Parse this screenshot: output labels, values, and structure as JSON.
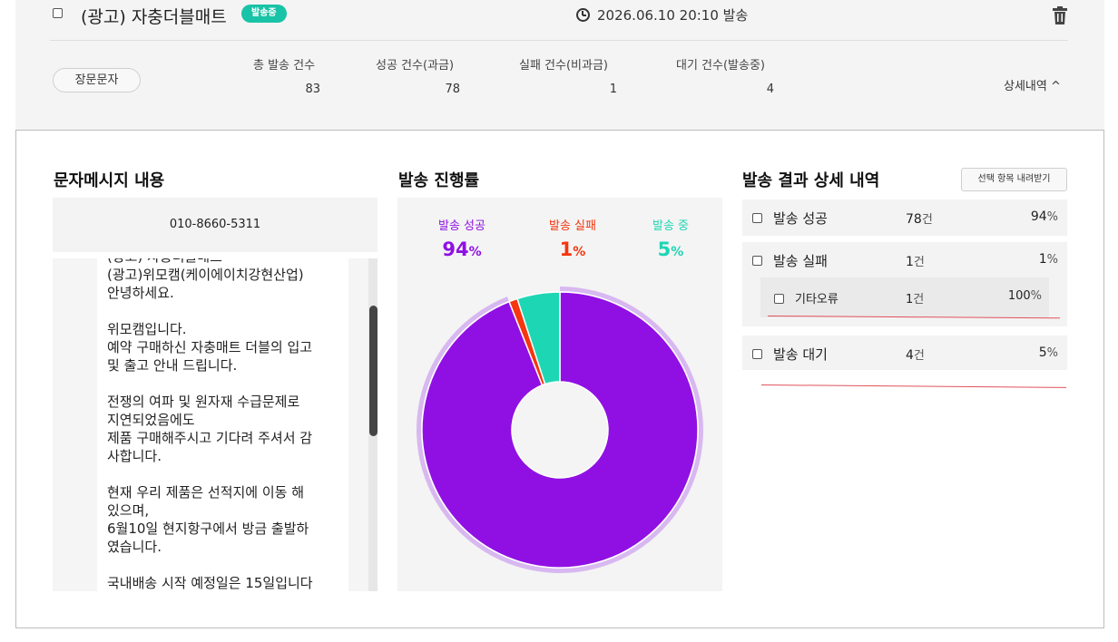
{
  "header": {
    "title": "(광고) 자충더블매트",
    "status_badge": "발송중",
    "scheduled": "2026.06.10 20:10 발송",
    "message_type": "장문문자",
    "detail_toggle": "상세내역 ^"
  },
  "stats": {
    "headers": [
      "총 발송 건수",
      "성공 건수(과금)",
      "실패 건수(비과금)",
      "대기 건수(발송중)"
    ],
    "values": [
      "83",
      "78",
      "1",
      "4"
    ]
  },
  "message": {
    "section_title": "문자메시지 내용",
    "phone": "010-8660-5311",
    "body": "(광고) 자충더블매트\n(광고)위모캠(케이에이치강현산업)\n안녕하세요.\n\n위모캠입니다.\n예약 구매하신 자충매트 더블의 입고\n및 출고 안내 드립니다.\n\n전쟁의 여파 및 원자재 수급문제로\n지연되었음에도\n제품 구매해주시고 기다려 주셔서 감\n사합니다.\n\n현재 우리 제품은 선적지에 이동 해\n있으며,\n6월10일 현지항구에서 방금 출발하\n였습니다.\n\n국내배송 시작 예정일은 15일입니다"
  },
  "progress": {
    "section_title": "발송 진행률",
    "legend": [
      {
        "label": "발송 성공",
        "value": "94",
        "unit": "%",
        "color": "#9010e3"
      },
      {
        "label": "발송 실패",
        "value": "1",
        "unit": "%",
        "color": "#f5360f"
      },
      {
        "label": "발송 중",
        "value": "5",
        "unit": "%",
        "color": "#1dd6b4"
      }
    ]
  },
  "chart_data": {
    "type": "pie",
    "categories": [
      "발송 성공",
      "발송 실패",
      "발송 중"
    ],
    "values": [
      94,
      1,
      5
    ],
    "colors": [
      "#9010e3",
      "#f5360f",
      "#1dd6b4"
    ],
    "donut": true
  },
  "results": {
    "section_title": "발송 결과 상세 내역",
    "download_button": "선택 항목 내려받기",
    "rows": [
      {
        "label": "발송 성공",
        "count": "78",
        "count_unit": "건",
        "pct": "94",
        "pct_unit": "%"
      },
      {
        "label": "발송 실패",
        "count": "1",
        "count_unit": "건",
        "pct": "1",
        "pct_unit": "%"
      },
      {
        "label": "발송 대기",
        "count": "4",
        "count_unit": "건",
        "pct": "5",
        "pct_unit": "%"
      }
    ],
    "sub_rows": [
      {
        "label": "기타오류",
        "count": "1",
        "count_unit": "건",
        "pct": "100",
        "pct_unit": "%"
      }
    ]
  }
}
